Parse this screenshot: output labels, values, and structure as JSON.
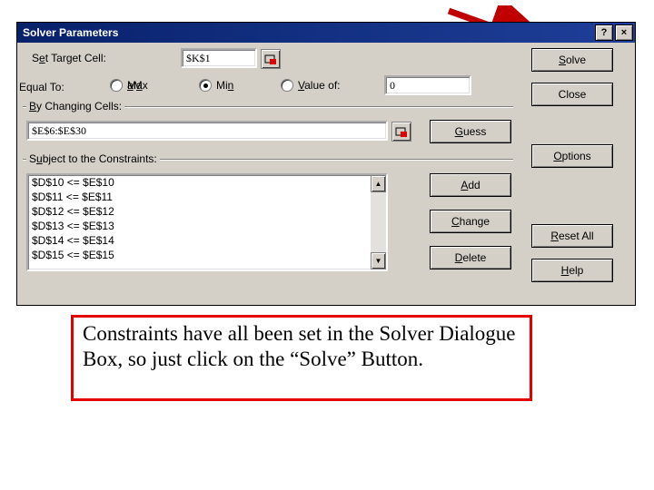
{
  "window": {
    "title": "Solver Parameters",
    "help_btn": "?",
    "close_btn": "×"
  },
  "labels": {
    "set_target_pre": "S",
    "set_target_mid": "e",
    "set_target_post": "t Target Cell:",
    "equal_to": "Equal To:",
    "max_pre": "M",
    "max_u": "a",
    "max_post": "x",
    "min_pre": "Mi",
    "min_u": "n",
    "min_post": "",
    "value_pre": "",
    "value_u": "V",
    "value_post": "alue of:",
    "changing_pre": "",
    "changing_u": "B",
    "changing_post": "y Changing Cells:",
    "subject_pre": "S",
    "subject_u": "u",
    "subject_post": "bject to the Constraints:"
  },
  "fields": {
    "target_cell": "$K$1",
    "value_of": "0",
    "changing_cells": "$E$6:$E$30"
  },
  "constraints": [
    "$D$10 <= $E$10",
    "$D$11 <= $E$11",
    "$D$12 <= $E$12",
    "$D$13 <= $E$13",
    "$D$14 <= $E$14",
    "$D$15 <= $E$15"
  ],
  "buttons": {
    "solve_u": "S",
    "solve_post": "olve",
    "close": "Close",
    "options_u": "O",
    "options_post": "ptions",
    "reset_u": "R",
    "reset_post": "eset All",
    "help_u": "H",
    "help_post": "elp",
    "guess_u": "G",
    "guess_post": "uess",
    "add_u": "A",
    "add_post": "dd",
    "change_u": "C",
    "change_post": "hange",
    "delete_u": "D",
    "delete_post": "elete"
  },
  "callout": "Constraints have all been set in the Solver Dialogue Box, so just click on the “Solve” Button."
}
